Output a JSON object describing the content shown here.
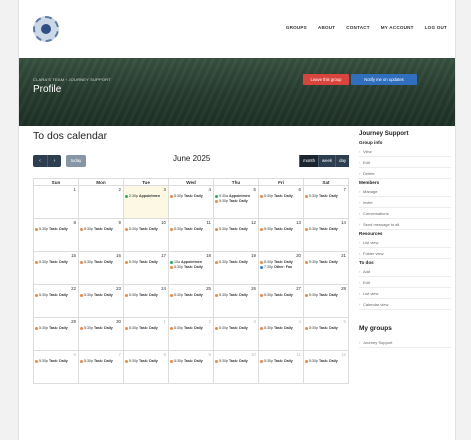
{
  "nav": {
    "items": [
      "GROUPS",
      "ABOUT",
      "CONTACT",
      "MY ACCOUNT",
      "LOG OUT"
    ]
  },
  "banner": {
    "breadcrumb": "CLARA'S TEAM  ›  JOURNEY SUPPORT",
    "title": "Profile",
    "leave_label": "Leave this group",
    "notify_label": "Notify me on updates"
  },
  "calendar": {
    "title": "To dos calendar",
    "prev_label": "‹",
    "next_label": "›",
    "today_label": "today",
    "month": "June 2025",
    "views": [
      "month",
      "week",
      "day"
    ],
    "active_view": "month",
    "weekdays": [
      "Sun",
      "Mon",
      "Tue",
      "Wed",
      "Thu",
      "Fri",
      "Sat"
    ],
    "colors": {
      "orange": "#f0883e",
      "green": "#27ae60",
      "blue": "#2f80ed",
      "today_bg": "#fcf8e3"
    },
    "weeks": [
      [
        {
          "day": "1",
          "events": []
        },
        {
          "day": "2",
          "events": []
        },
        {
          "day": "3",
          "today": true,
          "events": [
            {
              "color": "green",
              "time": "2:30p",
              "title": "Appointmen"
            }
          ]
        },
        {
          "day": "4",
          "events": [
            {
              "color": "orange",
              "time": "5:30p",
              "title": "Task: Daily"
            }
          ]
        },
        {
          "day": "5",
          "events": [
            {
              "color": "green",
              "time": "9:30a",
              "title": "Appointmen"
            },
            {
              "color": "orange",
              "time": "5:30p",
              "title": "Task: Daily"
            }
          ]
        },
        {
          "day": "6",
          "events": [
            {
              "color": "orange",
              "time": "5:30p",
              "title": "Task: Daily"
            }
          ]
        },
        {
          "day": "7",
          "events": [
            {
              "color": "orange",
              "time": "5:30p",
              "title": "Task: Daily"
            }
          ]
        }
      ],
      [
        {
          "day": "8",
          "events": [
            {
              "color": "orange",
              "time": "5:30p",
              "title": "Task: Daily"
            }
          ]
        },
        {
          "day": "9",
          "events": [
            {
              "color": "orange",
              "time": "5:30p",
              "title": "Task: Daily"
            }
          ]
        },
        {
          "day": "10",
          "events": [
            {
              "color": "orange",
              "time": "5:30p",
              "title": "Task: Daily"
            }
          ]
        },
        {
          "day": "11",
          "events": [
            {
              "color": "orange",
              "time": "5:30p",
              "title": "Task: Daily"
            }
          ]
        },
        {
          "day": "12",
          "events": [
            {
              "color": "orange",
              "time": "5:30p",
              "title": "Task: Daily"
            }
          ]
        },
        {
          "day": "13",
          "events": [
            {
              "color": "orange",
              "time": "5:30p",
              "title": "Task: Daily"
            }
          ]
        },
        {
          "day": "14",
          "events": [
            {
              "color": "orange",
              "time": "5:30p",
              "title": "Task: Daily"
            }
          ]
        }
      ],
      [
        {
          "day": "15",
          "events": [
            {
              "color": "orange",
              "time": "5:30p",
              "title": "Task: Daily"
            }
          ]
        },
        {
          "day": "16",
          "events": [
            {
              "color": "orange",
              "time": "5:30p",
              "title": "Task: Daily"
            }
          ]
        },
        {
          "day": "17",
          "events": [
            {
              "color": "orange",
              "time": "5:30p",
              "title": "Task: Daily"
            }
          ]
        },
        {
          "day": "18",
          "events": [
            {
              "color": "green",
              "time": "10a",
              "title": "Appointmen"
            },
            {
              "color": "orange",
              "time": "5:30p",
              "title": "Task: Daily"
            }
          ]
        },
        {
          "day": "19",
          "events": [
            {
              "color": "orange",
              "time": "5:30p",
              "title": "Task: Daily"
            }
          ]
        },
        {
          "day": "20",
          "events": [
            {
              "color": "orange",
              "time": "5:30p",
              "title": "Task: Daily"
            },
            {
              "color": "blue",
              "time": "7:30p",
              "title": "Other: Fan"
            }
          ]
        },
        {
          "day": "21",
          "events": [
            {
              "color": "orange",
              "time": "5:30p",
              "title": "Task: Daily"
            }
          ]
        }
      ],
      [
        {
          "day": "22",
          "events": [
            {
              "color": "orange",
              "time": "5:30p",
              "title": "Task: Daily"
            }
          ]
        },
        {
          "day": "23",
          "events": [
            {
              "color": "orange",
              "time": "5:30p",
              "title": "Task: Daily"
            }
          ]
        },
        {
          "day": "24",
          "events": [
            {
              "color": "orange",
              "time": "5:30p",
              "title": "Task: Daily"
            }
          ]
        },
        {
          "day": "25",
          "events": [
            {
              "color": "orange",
              "time": "5:30p",
              "title": "Task: Daily"
            }
          ]
        },
        {
          "day": "26",
          "events": [
            {
              "color": "orange",
              "time": "5:30p",
              "title": "Task: Daily"
            }
          ]
        },
        {
          "day": "27",
          "events": [
            {
              "color": "orange",
              "time": "5:30p",
              "title": "Task: Daily"
            }
          ]
        },
        {
          "day": "28",
          "events": [
            {
              "color": "orange",
              "time": "5:30p",
              "title": "Task: Daily"
            }
          ]
        }
      ],
      [
        {
          "day": "29",
          "events": [
            {
              "color": "orange",
              "time": "5:30p",
              "title": "Task: Daily"
            }
          ]
        },
        {
          "day": "30",
          "events": [
            {
              "color": "orange",
              "time": "5:30p",
              "title": "Task: Daily"
            }
          ]
        },
        {
          "day": "1",
          "other": true,
          "events": [
            {
              "color": "orange",
              "time": "5:30p",
              "title": "Task: Daily"
            }
          ]
        },
        {
          "day": "2",
          "other": true,
          "events": [
            {
              "color": "orange",
              "time": "5:30p",
              "title": "Task: Daily"
            }
          ]
        },
        {
          "day": "3",
          "other": true,
          "events": [
            {
              "color": "orange",
              "time": "5:30p",
              "title": "Task: Daily"
            }
          ]
        },
        {
          "day": "4",
          "other": true,
          "events": [
            {
              "color": "orange",
              "time": "5:30p",
              "title": "Task: Daily"
            }
          ]
        },
        {
          "day": "5",
          "other": true,
          "events": [
            {
              "color": "orange",
              "time": "5:30p",
              "title": "Task: Daily"
            }
          ]
        }
      ],
      [
        {
          "day": "6",
          "other": true,
          "events": [
            {
              "color": "orange",
              "time": "5:30p",
              "title": "Task: Daily"
            }
          ]
        },
        {
          "day": "7",
          "other": true,
          "events": [
            {
              "color": "orange",
              "time": "5:30p",
              "title": "Task: Daily"
            }
          ]
        },
        {
          "day": "8",
          "other": true,
          "events": [
            {
              "color": "orange",
              "time": "5:30p",
              "title": "Task: Daily"
            }
          ]
        },
        {
          "day": "9",
          "other": true,
          "events": [
            {
              "color": "orange",
              "time": "5:30p",
              "title": "Task: Daily"
            }
          ]
        },
        {
          "day": "10",
          "other": true,
          "events": [
            {
              "color": "orange",
              "time": "5:30p",
              "title": "Task: Daily"
            }
          ]
        },
        {
          "day": "11",
          "other": true,
          "events": [
            {
              "color": "orange",
              "time": "5:30p",
              "title": "Task: Daily"
            }
          ]
        },
        {
          "day": "12",
          "other": true,
          "events": [
            {
              "color": "orange",
              "time": "5:30p",
              "title": "Task: Daily"
            }
          ]
        }
      ]
    ]
  },
  "sidebar": {
    "title": "Journey Support",
    "sections": [
      {
        "heading": "Group info",
        "items": [
          "View",
          "Edit",
          "Delete"
        ]
      },
      {
        "heading": "Members",
        "items": [
          "Manage",
          "Invite",
          "Conversations",
          "Send message to all"
        ]
      },
      {
        "heading": "Resources",
        "items": [
          "List view",
          "Folder view"
        ]
      },
      {
        "heading": "To dos",
        "items": [
          "Add",
          "Edit",
          "List view",
          "Calendar view"
        ]
      }
    ],
    "my_groups_title": "My groups",
    "my_groups": [
      "Journey Support"
    ]
  }
}
